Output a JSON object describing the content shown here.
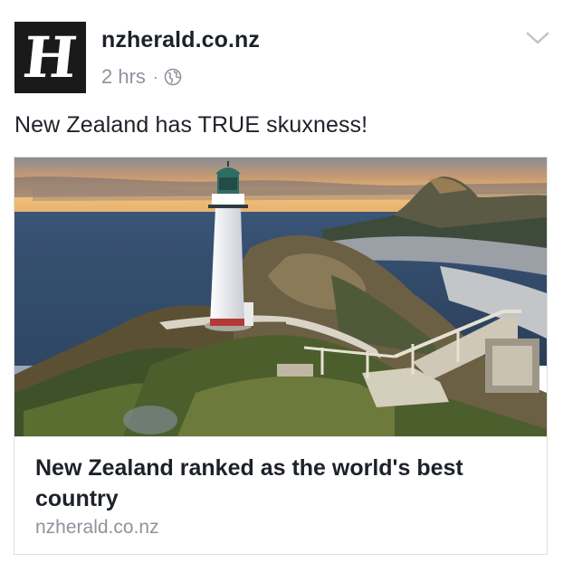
{
  "post": {
    "page_name": "nzherald.co.nz",
    "time": "2 hrs",
    "separator": "·",
    "privacy_icon": "globe-icon",
    "menu_icon": "chevron-down-icon",
    "logo_letter": "H",
    "text": "New Zealand has TRUE skuxness!"
  },
  "link": {
    "image_description_icon": "lighthouse-photo",
    "title": "New Zealand ranked as the world's best country",
    "domain": "nzherald.co.nz"
  },
  "colors": {
    "text_primary": "#1d2129",
    "text_secondary": "#8d949e",
    "border": "#dddfe2",
    "logo_bg": "#1a1a1a"
  }
}
